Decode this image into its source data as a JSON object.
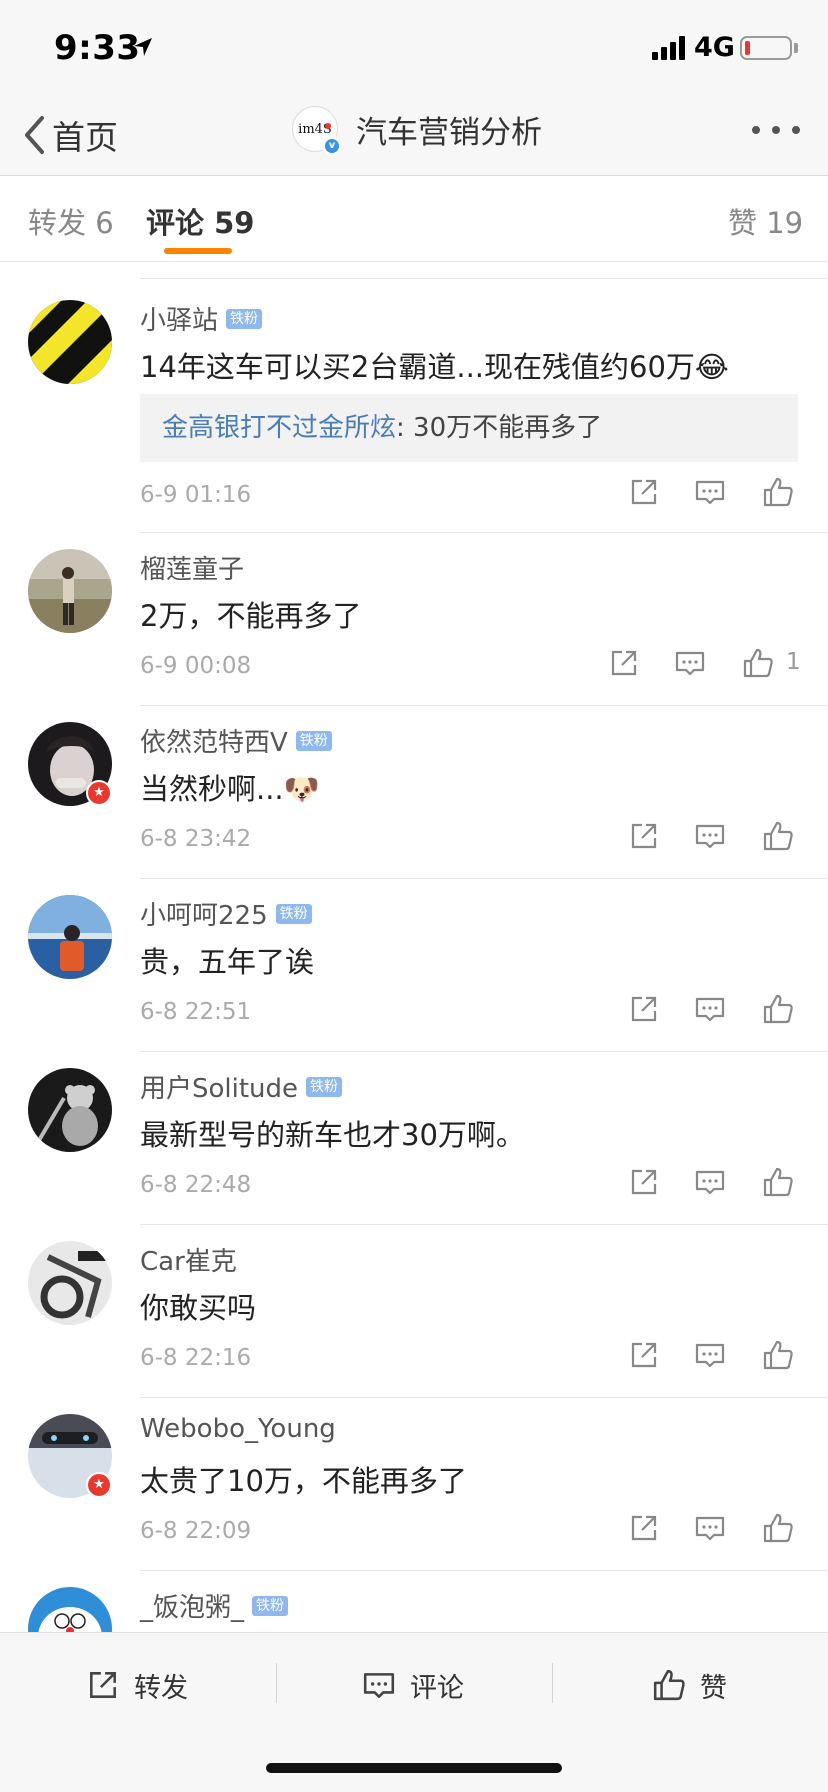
{
  "status_bar": {
    "time": "9:33",
    "network": "4G"
  },
  "nav": {
    "back_label": "首页",
    "title": "汽车营销分析",
    "avatar_text": "im4S"
  },
  "tabs": [
    {
      "label": "转发 6"
    },
    {
      "label": "评论 59"
    },
    {
      "label": "赞 19"
    }
  ],
  "fan_tag": "铁粉",
  "comments": [
    {
      "user": "小驿站",
      "fan": true,
      "text": "14年这车可以买2台霸道...现在残值约60万😂",
      "reply_user": "金高银打不过金所炫",
      "reply_text": ": 30万不能再多了",
      "time": "6-9 01:16",
      "likes": ""
    },
    {
      "user": "榴莲童子",
      "fan": false,
      "text": "2万，不能再多了",
      "time": "6-9 00:08",
      "likes": "1"
    },
    {
      "user": "依然范特西V",
      "fan": true,
      "text": "当然秒啊...🐶",
      "time": "6-8 23:42",
      "likes": ""
    },
    {
      "user": "小呵呵225",
      "fan": true,
      "text": "贵，五年了诶",
      "time": "6-8 22:51",
      "likes": ""
    },
    {
      "user": "用户Solitude",
      "fan": true,
      "text": "最新型号的新车也才30万啊。",
      "time": "6-8 22:48",
      "likes": ""
    },
    {
      "user": "Car崔克",
      "fan": false,
      "text": "你敢买吗",
      "time": "6-8 22:16",
      "likes": ""
    },
    {
      "user": "Webobo_Young",
      "fan": false,
      "text": "太贵了10万，不能再多了",
      "time": "6-8 22:09",
      "likes": ""
    },
    {
      "user": "_饭泡粥_",
      "fan": true,
      "text": "",
      "time": "",
      "likes": ""
    }
  ],
  "bottom_bar": {
    "repost": "转发",
    "comment": "评论",
    "like": "赞"
  },
  "colors": {
    "accent": "#ff8200",
    "link": "#4a7cb8",
    "fan_tag": "#8fb8ee",
    "badge_red": "#e8392f"
  }
}
